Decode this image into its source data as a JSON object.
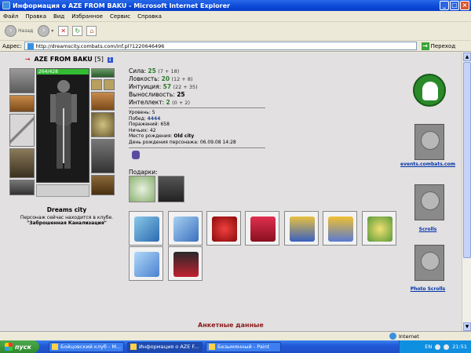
{
  "window": {
    "title": "Информация о AZE FROM BAKU - Microsoft Internet Explorer"
  },
  "menu": [
    "Файл",
    "Правка",
    "Вид",
    "Избранное",
    "Сервис",
    "Справка"
  ],
  "toolbar": {
    "back_label": "Назад"
  },
  "address": {
    "label": "Адрес:",
    "url": "http://dreamscity.combats.com/inf.pl?1220646496",
    "go_label": "Переход"
  },
  "character": {
    "name": "AZE FROM BAKU",
    "level": "[5]",
    "hp": "264/428",
    "city": "Dreams city",
    "location_line": "Персонаж сейчас находится в клубе.",
    "location_place": "\"Заброшенная Канализация\""
  },
  "stats": [
    {
      "label": "Сила:",
      "value": "25",
      "bonus": "(7 + 18)"
    },
    {
      "label": "Ловкость:",
      "value": "20",
      "bonus": "(12 + 8)"
    },
    {
      "label": "Интуиция:",
      "value": "57",
      "bonus": "(22 + 35)"
    },
    {
      "label": "Выносливость:",
      "value": "25",
      "bonus": ""
    },
    {
      "label": "Интеллект:",
      "value": "2",
      "bonus": "(0 + 2)"
    }
  ],
  "details": [
    {
      "label": "Уровень:",
      "value": "5"
    },
    {
      "label": "Побед:",
      "value": "4444"
    },
    {
      "label": "Поражений:",
      "value": "658"
    },
    {
      "label": "Ничьих:",
      "value": "42"
    },
    {
      "label": "Место рождения:",
      "value": "Old city"
    },
    {
      "label": "День рождения персонажа:",
      "value": "06.09.08 14:28"
    }
  ],
  "gifts": {
    "label": "Подарки:"
  },
  "sidebar": {
    "events_link": "events.combats.com",
    "scrolls_link": "Scrolls",
    "photo_link": "Photo Scrolls"
  },
  "section_heading": "Анкетные данные",
  "statusbar": {
    "zone": "Internet"
  },
  "taskbar": {
    "start_label": "пуск",
    "tasks": [
      "Бойцовский клуб - M...",
      "Информация о AZE F...",
      "Безымянный - Paint"
    ],
    "lang": "EN",
    "clock": "21:51"
  },
  "colors": {
    "title_blue": "#0a48d6",
    "stat_green": "#2a7a2a",
    "link_blue": "#0033aa",
    "heading_red": "#8a1a1a"
  }
}
